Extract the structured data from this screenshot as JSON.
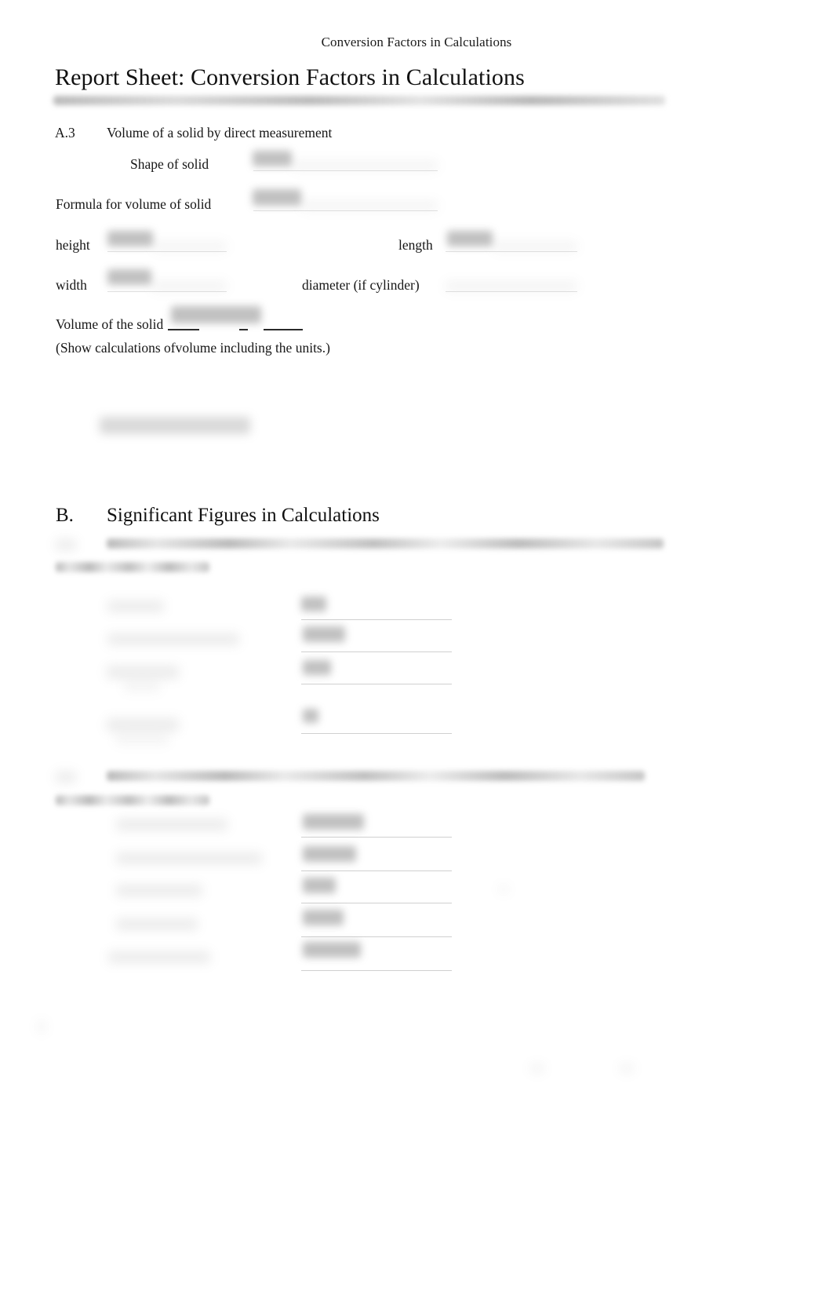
{
  "document": {
    "running_head": "Conversion Factors in Calculations",
    "title": "Report Sheet: Conversion Factors in Calculations",
    "redacted_header_note": "[redacted / blurred line]"
  },
  "section_a": {
    "number": "A.3",
    "heading": "Volume of a solid by direct measurement",
    "fields": [
      {
        "label": "Shape of solid",
        "value": "[blurred handwriting]"
      },
      {
        "label": "Formula for volume of solid",
        "value": "[blurred handwriting]"
      },
      {
        "label": "height",
        "value": "[blurred handwriting]"
      },
      {
        "label": "length",
        "value": "[blurred handwriting]"
      },
      {
        "label": "width",
        "value": "[blurred handwriting]"
      },
      {
        "label": "diameter (if cylinder)",
        "value": ""
      }
    ],
    "volume_label": "Volume of the solid",
    "volume_value": "[blurred handwriting]",
    "show_work_note": "(Show calculations ofvolume including the units.)",
    "work_area_value": "[blurred handwriting]"
  },
  "section_b": {
    "letter": "B.",
    "title": "Significant Figures in Calculations",
    "b1": {
      "number": "B.1",
      "prompt": "[blurred instruction text]",
      "prompt_line_2": "[blurred instruction text]",
      "problems": [
        {
          "expression": "[blurred]",
          "answer": "[blurred]"
        },
        {
          "expression": "[blurred]",
          "answer": "[blurred]"
        },
        {
          "expression": "[blurred]",
          "answer": "[blurred]"
        },
        {
          "expression": "[blurred]",
          "answer": "[blurred]"
        }
      ]
    },
    "b2": {
      "number": "B.2",
      "prompt": "[blurred instruction text]",
      "prompt_line_2": "[blurred instruction text]",
      "problems": [
        {
          "expression": "[blurred]",
          "answer": "[blurred]"
        },
        {
          "expression": "[blurred]",
          "answer": "[blurred]"
        },
        {
          "expression": "[blurred]",
          "answer": "[blurred]"
        },
        {
          "expression": "[blurred]",
          "answer": "[blurred]"
        },
        {
          "expression": "[blurred]",
          "answer": "[blurred]"
        }
      ]
    }
  }
}
